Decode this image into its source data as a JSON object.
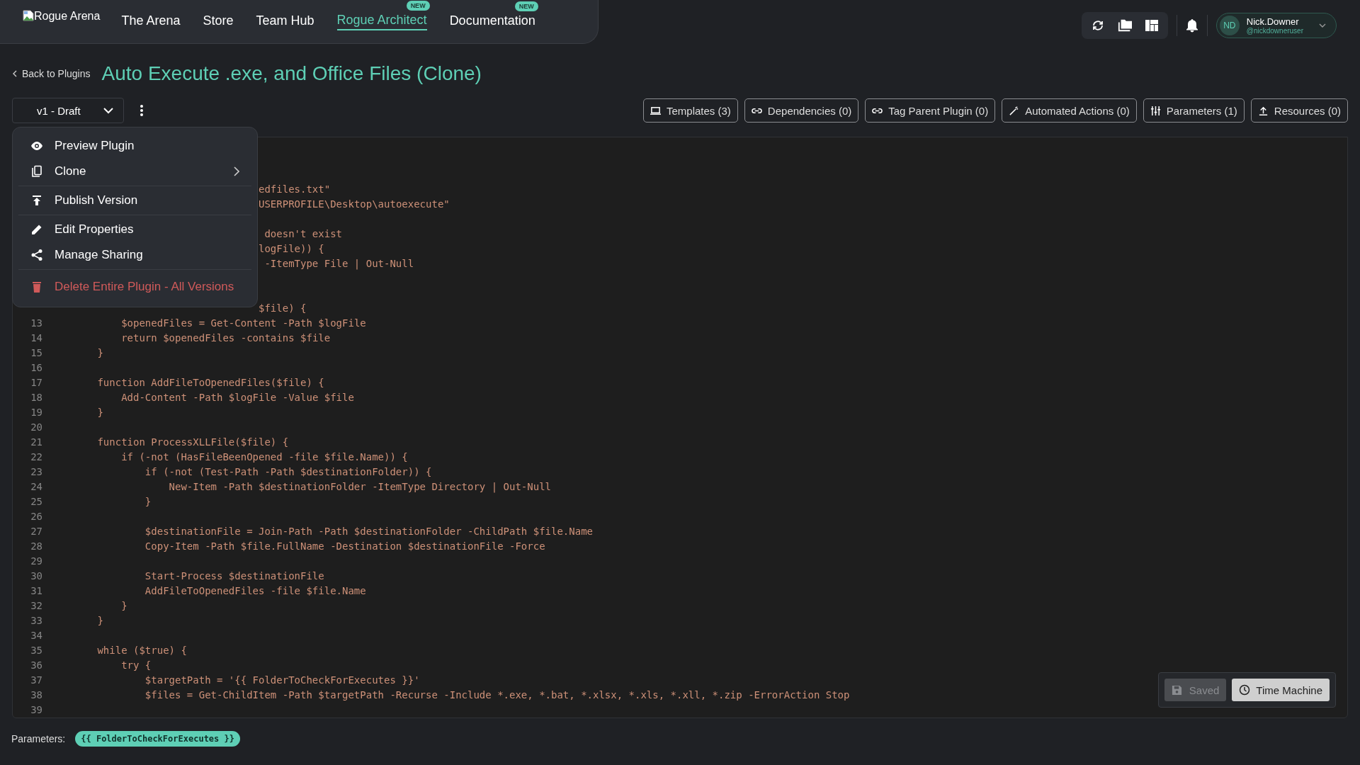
{
  "nav": {
    "logo": "Rogue Arena",
    "items": [
      {
        "label": "The Arena",
        "selected": false
      },
      {
        "label": "Store",
        "selected": false
      },
      {
        "label": "Team Hub",
        "selected": false
      },
      {
        "label": "Rogue Architect",
        "selected": true,
        "badge": "NEW"
      },
      {
        "label": "Documentation",
        "selected": false,
        "badge": "NEW"
      }
    ]
  },
  "user": {
    "initials": "ND",
    "name": "Nick.Downer",
    "handle": "@nickdowneruser"
  },
  "back_link": "Back to Plugins",
  "title": "Auto Execute .exe, and Office Files (Clone)",
  "version_select": {
    "value": "v1 - Draft"
  },
  "tool_buttons": [
    "Templates (3)",
    "Dependencies (0)",
    "Tag Parent Plugin (0)",
    "Automated Actions (0)",
    "Parameters (1)",
    "Resources (0)"
  ],
  "menu": {
    "items": [
      {
        "label": "Preview Plugin",
        "kind": "action",
        "divider_after": false
      },
      {
        "label": "Clone",
        "kind": "submenu",
        "divider_after": true
      },
      {
        "label": "Publish Version",
        "kind": "action",
        "divider_after": true
      },
      {
        "label": "Edit Properties",
        "kind": "action",
        "divider_after": false
      },
      {
        "label": "Manage Sharing",
        "kind": "action",
        "divider_after": true
      },
      {
        "label": "Delete Entire Plugin - All Versions",
        "kind": "danger",
        "divider_after": false
      }
    ]
  },
  "code": {
    "lines": [
      {
        "kind": "covered"
      },
      {
        "kind": "covered"
      },
      {
        "kind": "covered"
      },
      {
        "kind": "covered",
        "text": "                                   edfiles.txt\""
      },
      {
        "kind": "covered",
        "text": "                                   USERPROFILE\\Desktop\\autoexecute\""
      },
      {
        "kind": "covered"
      },
      {
        "kind": "covered",
        "text": "                                    doesn't exist"
      },
      {
        "kind": "covered",
        "text": "                                   logFile)) {"
      },
      {
        "kind": "covered",
        "text": "                                    -ItemType File | Out-Null"
      },
      {
        "kind": "covered"
      },
      {
        "kind": "covered"
      },
      {
        "kind": "covered",
        "text": "                                   $file) {"
      },
      {
        "kind": "code",
        "number": "13",
        "text": "            $openedFiles = Get-Content -Path $logFile"
      },
      {
        "kind": "code",
        "number": "14",
        "text": "            return $openedFiles -contains $file"
      },
      {
        "kind": "code",
        "number": "15",
        "text": "        }"
      },
      {
        "kind": "code",
        "number": "16"
      },
      {
        "kind": "code",
        "number": "17",
        "text": "        function AddFileToOpenedFiles($file) {"
      },
      {
        "kind": "code",
        "number": "18",
        "text": "            Add-Content -Path $logFile -Value $file"
      },
      {
        "kind": "code",
        "number": "19",
        "text": "        }"
      },
      {
        "kind": "code",
        "number": "20"
      },
      {
        "kind": "code",
        "number": "21",
        "text": "        function ProcessXLLFile($file) {"
      },
      {
        "kind": "code",
        "number": "22",
        "text": "            if (-not (HasFileBeenOpened -file $file.Name)) {"
      },
      {
        "kind": "code",
        "number": "23",
        "text": "                if (-not (Test-Path -Path $destinationFolder)) {"
      },
      {
        "kind": "code",
        "number": "24",
        "text": "                    New-Item -Path $destinationFolder -ItemType Directory | Out-Null"
      },
      {
        "kind": "code",
        "number": "25",
        "text": "                }"
      },
      {
        "kind": "code",
        "number": "26"
      },
      {
        "kind": "code",
        "number": "27",
        "text": "                $destinationFile = Join-Path -Path $destinationFolder -ChildPath $file.Name"
      },
      {
        "kind": "code",
        "number": "28",
        "text": "                Copy-Item -Path $file.FullName -Destination $destinationFile -Force"
      },
      {
        "kind": "code",
        "number": "29"
      },
      {
        "kind": "code",
        "number": "30",
        "text": "                Start-Process $destinationFile"
      },
      {
        "kind": "code",
        "number": "31",
        "text": "                AddFileToOpenedFiles -file $file.Name"
      },
      {
        "kind": "code",
        "number": "32",
        "text": "            }"
      },
      {
        "kind": "code",
        "number": "33",
        "text": "        }"
      },
      {
        "kind": "code",
        "number": "34"
      },
      {
        "kind": "code",
        "number": "35",
        "text": "        while ($true) {"
      },
      {
        "kind": "code",
        "number": "36",
        "text": "            try {"
      },
      {
        "kind": "code",
        "number": "37",
        "text": "                $targetPath = '{{ FolderToCheckForExecutes }}'"
      },
      {
        "kind": "code",
        "number": "38",
        "text": "                $files = Get-ChildItem -Path $targetPath -Recurse -Include *.exe, *.bat, *.xlsx, *.xls, *.xll, *.zip -ErrorAction Stop"
      },
      {
        "kind": "code",
        "number": "39"
      }
    ]
  },
  "save_button": {
    "label": "Saved",
    "disabled": true
  },
  "time_machine_button": "Time Machine",
  "parameters": {
    "label": "Parameters:",
    "tags": [
      "{{ FolderToCheckForExecutes }}"
    ]
  }
}
